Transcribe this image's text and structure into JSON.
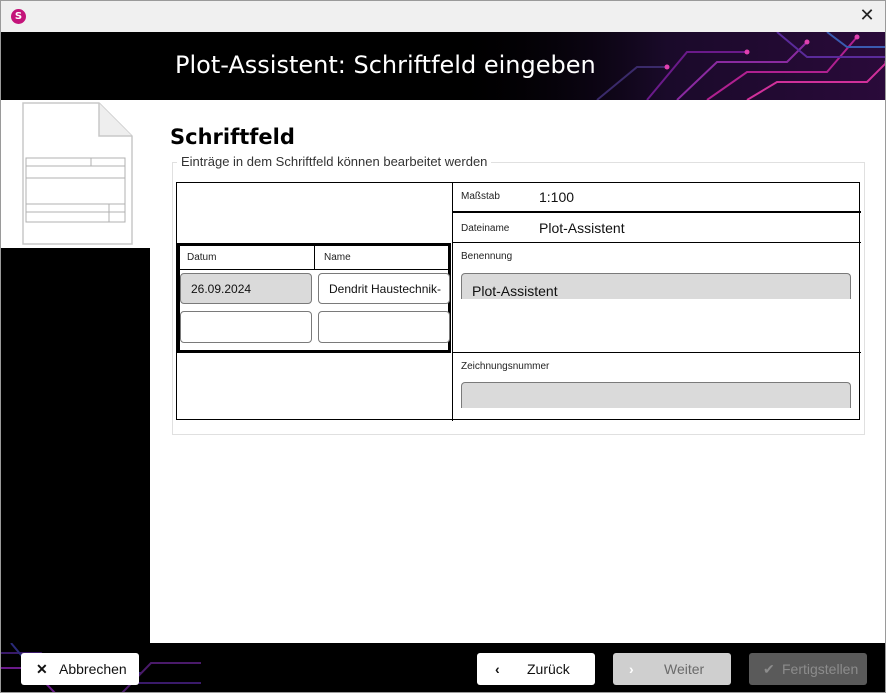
{
  "window": {
    "close_glyph": "✕",
    "app_icon_letter": "S"
  },
  "header": {
    "title": "Plot-Assistent: Schriftfeld eingeben"
  },
  "content": {
    "section_title": "Schriftfeld",
    "group_caption": "Einträge in dem Schriftfeld können bearbeitet werden"
  },
  "titleblock": {
    "massstab_label": "Maßstab",
    "massstab_value": "1:100",
    "dateiname_label": "Dateiname",
    "dateiname_value": "Plot-Assistent",
    "datum_label": "Datum",
    "name_label": "Name",
    "datum_value": "26.09.2024",
    "name_value": "Dendrit Haustechnik-",
    "benennung_label": "Benennung",
    "benennung_value": "Plot-Assistent",
    "zeichnungsnummer_label": "Zeichnungsnummer",
    "zeichnungsnummer_value": ""
  },
  "footer": {
    "cancel_label": "Abbrechen",
    "back_label": "Zurück",
    "next_label": "Weiter",
    "finish_label": "Fertigstellen",
    "cancel_icon": "close-icon",
    "back_icon": "chevron-left-icon",
    "next_icon": "chevron-right-icon",
    "finish_icon": "checkmark-icon"
  },
  "colors": {
    "banner_bg": "#000000",
    "accent_magenta": "#c4147a",
    "field_grey": "#dadada"
  }
}
